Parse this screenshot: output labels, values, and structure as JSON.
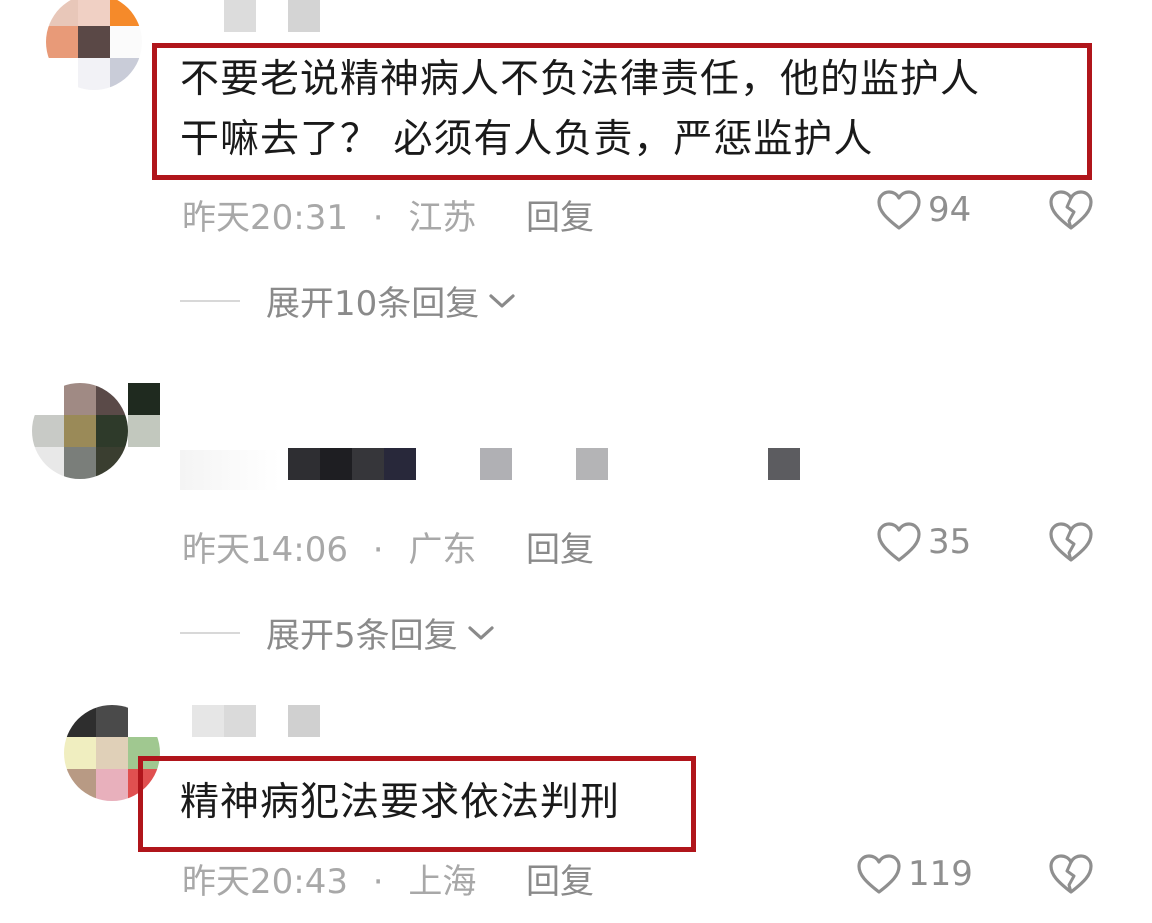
{
  "comments": [
    {
      "text_line1": "不要老说精神病人不负法律责任，他的监护人",
      "text_line2": "干嘛去了？ 必须有人负责，严惩监护人",
      "time": "昨天20:31",
      "sep": "·",
      "location": "江苏",
      "reply_label": "回复",
      "likes": "94",
      "expand_label": "展开10条回复"
    },
    {
      "time": "昨天14:06",
      "sep": "·",
      "location": "广东",
      "reply_label": "回复",
      "likes": "35",
      "expand_label": "展开5条回复"
    },
    {
      "text_line1": "精神病犯法要求依法判刑",
      "time": "昨天20:43",
      "sep": "·",
      "location": "上海",
      "reply_label": "回复",
      "likes": "119"
    }
  ],
  "icons": {
    "like": "heart-outline-icon",
    "dislike": "broken-heart-icon",
    "expand": "chevron-down-icon"
  },
  "colors": {
    "highlight_border": "#b0151b",
    "meta_text": "#a8a8a8",
    "body_text": "#1a1a1a"
  }
}
